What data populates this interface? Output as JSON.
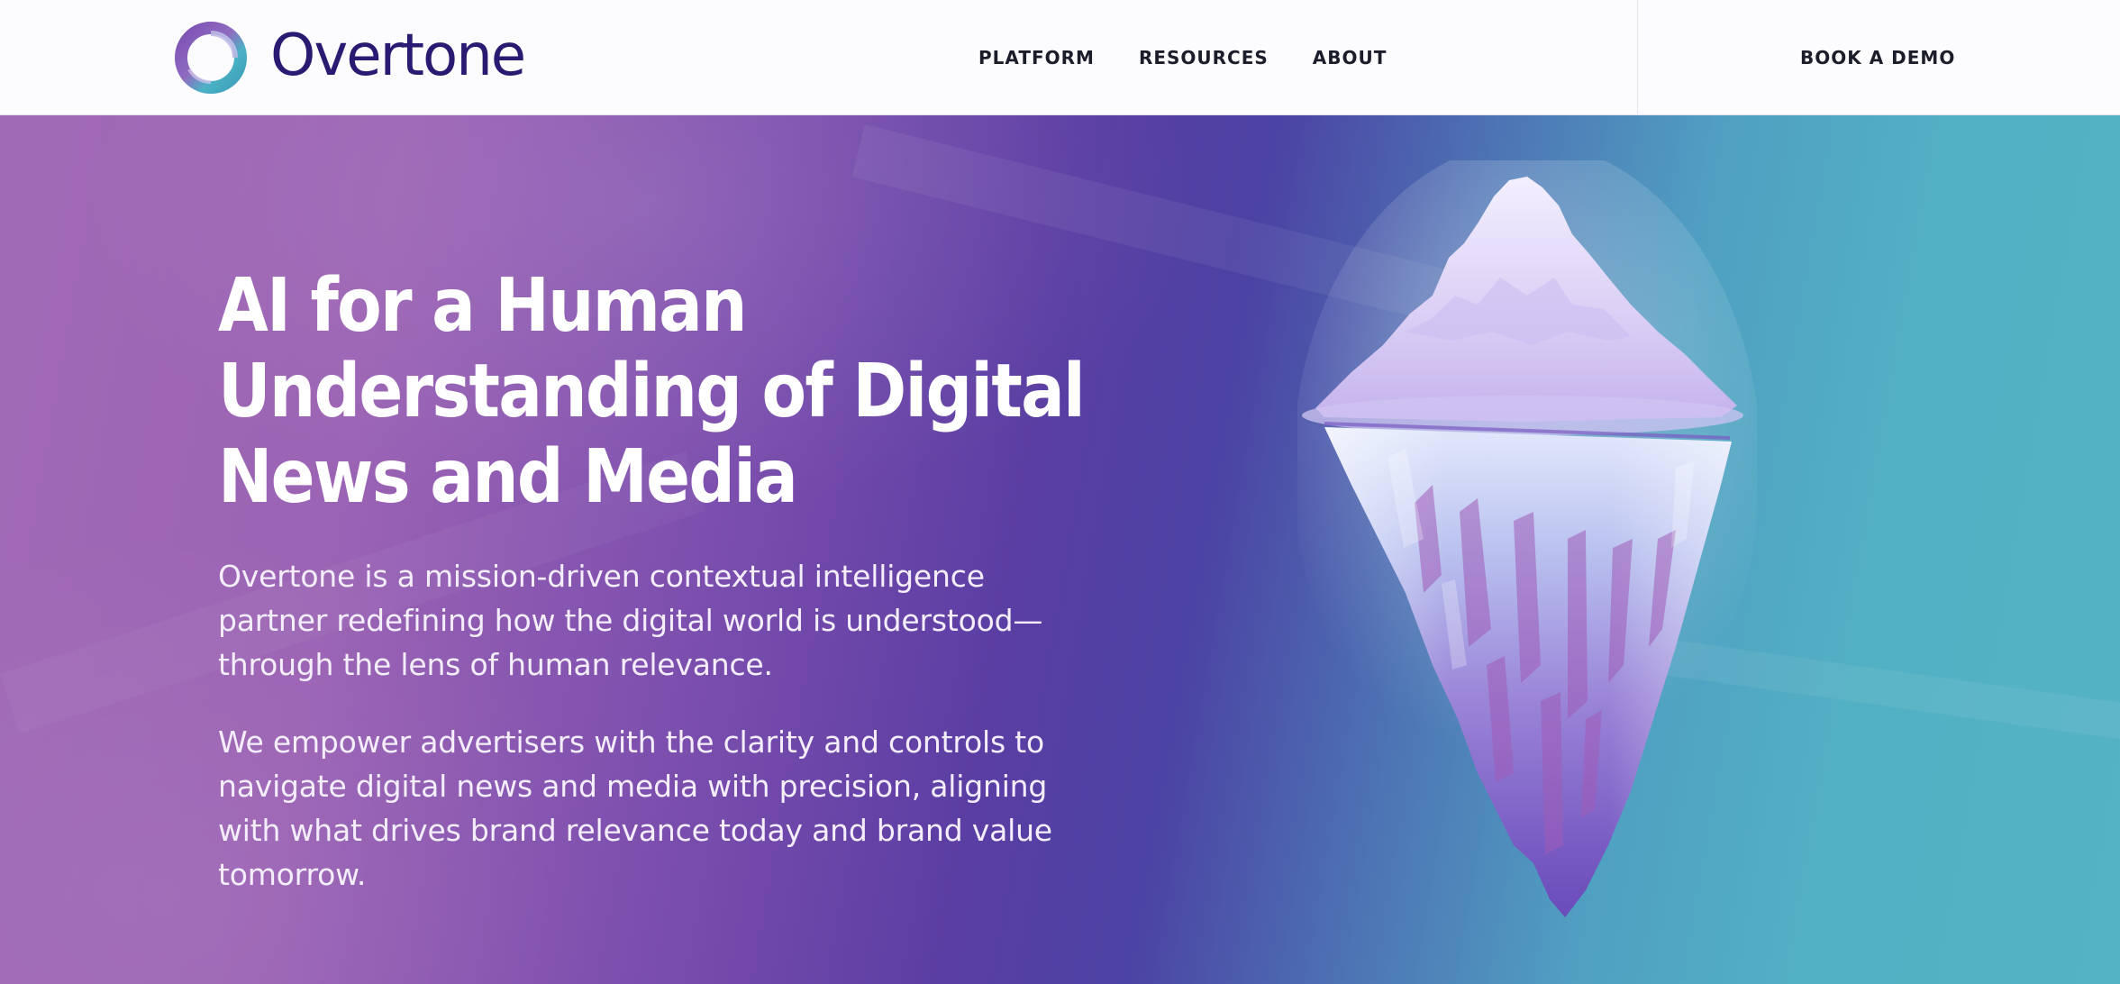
{
  "brand": {
    "name": "Overtone",
    "colors": {
      "logo_text": "#2b1a72",
      "ring_purple": "#6a4fb0",
      "ring_teal": "#3bb6c4",
      "hero_purple": "#9b63b4",
      "hero_teal": "#54b3c5"
    }
  },
  "nav": {
    "items": [
      {
        "label": "PLATFORM"
      },
      {
        "label": "RESOURCES"
      },
      {
        "label": "ABOUT"
      }
    ],
    "cta_label": "BOOK A DEMO"
  },
  "hero": {
    "headline_lines": [
      "AI for a Human",
      "Understanding of Digital",
      "News and Media"
    ],
    "paragraph_1": "Overtone is a mission-driven contextual intelligence partner redefining how the digital world is understood— through the lens of human relevance.",
    "paragraph_2": "We empower advertisers with the clarity and controls to navigate digital news and media with precision, aligning with what drives brand relevance today and brand value tomorrow.",
    "image_icon": "iceberg-illustration"
  }
}
